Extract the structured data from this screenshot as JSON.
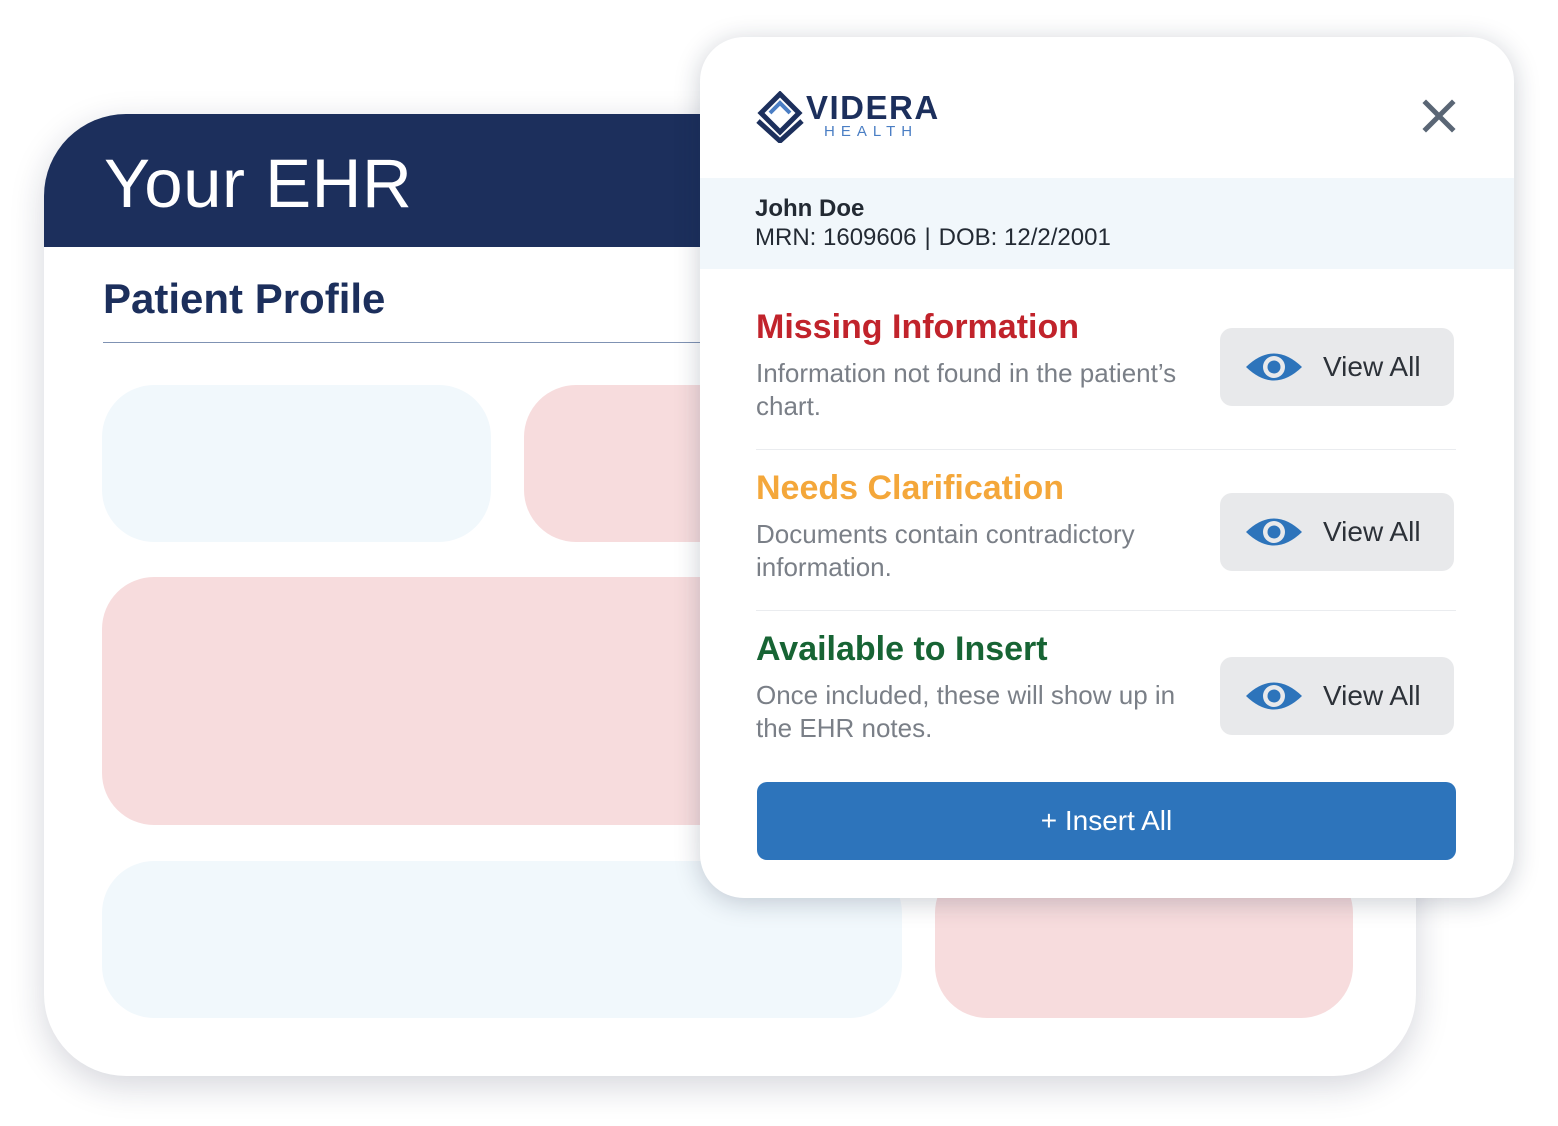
{
  "ehr": {
    "title": "Your EHR",
    "section_title": "Patient Profile",
    "colors": {
      "header": "#1c2f5c",
      "block_blue": "#f1f8fc",
      "block_red": "#f7dcdd"
    }
  },
  "popup": {
    "brand": {
      "name": "VIDERA",
      "sub": "HEALTH"
    },
    "close_icon": "close-icon",
    "patient": {
      "name": "John Doe",
      "mrn": "MRN: 1609606",
      "separator": "|",
      "dob": "DOB: 12/2/2001"
    },
    "sections": [
      {
        "title": "Missing Information",
        "description": "Information not found in the patient’s chart.",
        "color": "#c1232b",
        "button_label": "View All",
        "button_icon": "eye-icon"
      },
      {
        "title": "Needs Clarification",
        "description": "Documents contain contradictory information.",
        "color": "#f4a73a",
        "button_label": "View All",
        "button_icon": "eye-icon"
      },
      {
        "title": "Available to Insert",
        "description": "Once included, these will show up in the EHR notes.",
        "color": "#176434",
        "button_label": "View All",
        "button_icon": "eye-icon"
      }
    ],
    "insert_all_label": "+ Insert All",
    "colors": {
      "accent": "#2d74bb",
      "button_bg": "#e8e9eb",
      "eye": "#2d74bb"
    }
  }
}
